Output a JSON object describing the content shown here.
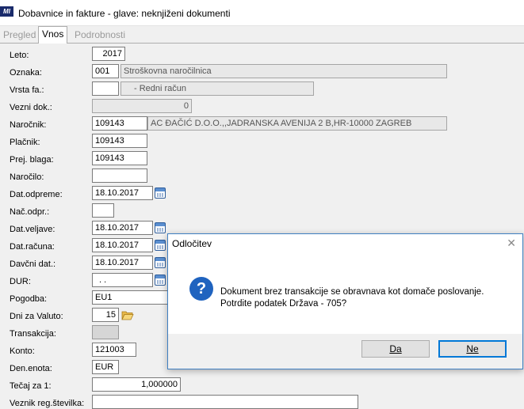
{
  "window": {
    "title": "Dobavnice in fakture - glave: neknjiženi dokumenti",
    "logo_text": "MI"
  },
  "tabs": [
    {
      "label": "Pregled",
      "active": false
    },
    {
      "label": "Vnos",
      "active": true
    },
    {
      "label": "Podrobnosti",
      "active": false
    }
  ],
  "form": {
    "leto": {
      "label": "Leto:",
      "value": "2017"
    },
    "oznaka": {
      "label": "Oznaka:",
      "value": "001",
      "desc": "Stroškovna naročilnica"
    },
    "vrsta_fa": {
      "label": "Vrsta fa.:",
      "value": "",
      "desc": "- Redni račun"
    },
    "vezni_dok": {
      "label": "Vezni dok.:",
      "value": "0"
    },
    "narocnik": {
      "label": "Naročnik:",
      "value": "109143",
      "desc": "AC ĐAČIĆ D.O.O.,,JADRANSKA AVENIJA 2 B,HR-10000 ZAGREB"
    },
    "placnik": {
      "label": "Plačnik:",
      "value": "109143"
    },
    "prej_blaga": {
      "label": "Prej. blaga:",
      "value": "109143"
    },
    "narocilo": {
      "label": "Naročilo:",
      "value": ""
    },
    "dat_odpreme": {
      "label": "Dat.odpreme:",
      "value": "18.10.2017"
    },
    "nac_odpr": {
      "label": "Nač.odpr.:",
      "value": ""
    },
    "dat_veljave": {
      "label": "Dat.veljave:",
      "value": "18.10.2017"
    },
    "dat_racuna": {
      "label": "Dat.računa:",
      "value": "18.10.2017"
    },
    "davcni_dat": {
      "label": "Davčni dat.:",
      "value": "18.10.2017"
    },
    "dur": {
      "label": "DUR:",
      "value": ". ."
    },
    "pogodba": {
      "label": "Pogodba:",
      "value": "EU1"
    },
    "dni_za_valuto": {
      "label": "Dni za Valuto:",
      "value": "15"
    },
    "transakcija": {
      "label": "Transakcija:",
      "value": ""
    },
    "konto": {
      "label": "Konto:",
      "value": "121003"
    },
    "den_enota": {
      "label": "Den.enota:",
      "value": "EUR"
    },
    "tecaj": {
      "label": "Tečaj za 1:",
      "value": "1,000000"
    },
    "veznik_reg": {
      "label": "Veznik reg.številka:",
      "value": ""
    }
  },
  "dialog": {
    "title": "Odločitev",
    "message_line1": "Dokument brez transakcije se obravnava kot domače poslovanje.",
    "message_line2": "Potrdite podatek Država - 705?",
    "yes_label": "Da",
    "no_label": "Ne",
    "icon": "question-icon"
  }
}
